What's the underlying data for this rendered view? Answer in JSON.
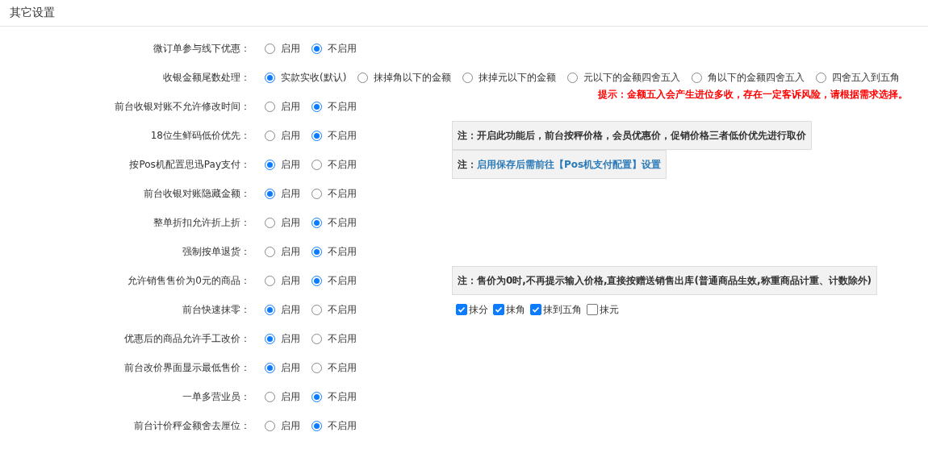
{
  "section_title": "其它设置",
  "settings": [
    {
      "label": "微订单参与线下优惠：",
      "options": [
        {
          "label": "启用",
          "selected": false
        },
        {
          "label": "不启用",
          "selected": true
        }
      ]
    },
    {
      "label": "收银金额尾数处理：",
      "options": [
        {
          "label": "实款实收(默认)",
          "selected": true
        },
        {
          "label": "抹掉角以下的金额",
          "selected": false
        },
        {
          "label": "抹掉元以下的金额",
          "selected": false
        },
        {
          "label": "元以下的金额四舍五入",
          "selected": false
        },
        {
          "label": "角以下的金额四舍五入",
          "selected": false
        },
        {
          "label": "四舍五入到五角",
          "selected": false
        }
      ],
      "tip": "提示：金额五入会产生进位多收，存在一定客诉风险，请根据需求选择。"
    },
    {
      "label": "前台收银对账不允许修改时间：",
      "options": [
        {
          "label": "启用",
          "selected": false
        },
        {
          "label": "不启用",
          "selected": true
        }
      ]
    },
    {
      "label": "18位生鲜码低价优先：",
      "options": [
        {
          "label": "启用",
          "selected": false
        },
        {
          "label": "不启用",
          "selected": true
        }
      ],
      "note": {
        "kind": "plain",
        "prefix": "注：",
        "text": "开启此功能后，前台按秤价格，会员优惠价，促销价格三者低价优先进行取价"
      }
    },
    {
      "label": "按Pos机配置思迅Pay支付：",
      "options": [
        {
          "label": "启用",
          "selected": true
        },
        {
          "label": "不启用",
          "selected": false
        }
      ],
      "note": {
        "kind": "link",
        "prefix": "注：",
        "text": "启用保存后需前往【Pos机支付配置】设置"
      }
    },
    {
      "label": "前台收银对账隐藏金额：",
      "options": [
        {
          "label": "启用",
          "selected": true
        },
        {
          "label": "不启用",
          "selected": false
        }
      ]
    },
    {
      "label": "整单折扣允许折上折：",
      "options": [
        {
          "label": "启用",
          "selected": false
        },
        {
          "label": "不启用",
          "selected": true
        }
      ]
    },
    {
      "label": "强制按单退货：",
      "options": [
        {
          "label": "启用",
          "selected": false
        },
        {
          "label": "不启用",
          "selected": true
        }
      ]
    },
    {
      "label": "允许销售售价为0元的商品：",
      "options": [
        {
          "label": "启用",
          "selected": false
        },
        {
          "label": "不启用",
          "selected": true
        }
      ],
      "note": {
        "kind": "plain",
        "prefix": "注：",
        "text": "售价为0时,不再提示输入价格,直接按赠送销售出库(普通商品生效,称重商品计重、计数除外)"
      }
    },
    {
      "label": "前台快速抹零：",
      "options": [
        {
          "label": "启用",
          "selected": true
        },
        {
          "label": "不启用",
          "selected": false
        }
      ],
      "checkboxes": [
        {
          "label": "抹分",
          "checked": true
        },
        {
          "label": "抹角",
          "checked": true
        },
        {
          "label": "抹到五角",
          "checked": true
        },
        {
          "label": "抹元",
          "checked": false
        }
      ]
    },
    {
      "label": "优惠后的商品允许手工改价：",
      "options": [
        {
          "label": "启用",
          "selected": true
        },
        {
          "label": "不启用",
          "selected": false
        }
      ]
    },
    {
      "label": "前台改价界面显示最低售价：",
      "options": [
        {
          "label": "启用",
          "selected": true
        },
        {
          "label": "不启用",
          "selected": false
        }
      ]
    },
    {
      "label": "一单多营业员：",
      "options": [
        {
          "label": "启用",
          "selected": false
        },
        {
          "label": "不启用",
          "selected": true
        }
      ]
    },
    {
      "label": "前台计价秤金额舍去厘位：",
      "options": [
        {
          "label": "启用",
          "selected": false
        },
        {
          "label": "不启用",
          "selected": true
        }
      ]
    }
  ]
}
